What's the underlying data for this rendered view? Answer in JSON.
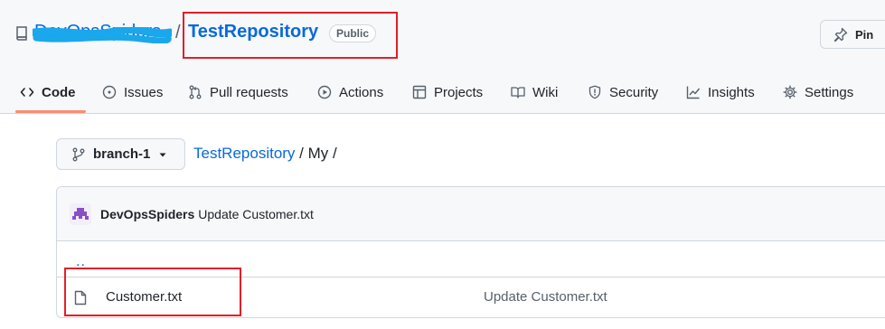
{
  "repo": {
    "owner": "DevOpsSpiders",
    "separator": "/",
    "name": "TestRepository",
    "visibility": "Public"
  },
  "header": {
    "pin_label": "Pin"
  },
  "nav": {
    "tabs": [
      {
        "label": "Code",
        "icon": "code-icon",
        "active": true
      },
      {
        "label": "Issues",
        "icon": "issue-opened-icon"
      },
      {
        "label": "Pull requests",
        "icon": "git-pull-request-icon"
      },
      {
        "label": "Actions",
        "icon": "play-icon"
      },
      {
        "label": "Projects",
        "icon": "table-icon"
      },
      {
        "label": "Wiki",
        "icon": "book-icon"
      },
      {
        "label": "Security",
        "icon": "shield-icon"
      },
      {
        "label": "Insights",
        "icon": "graph-icon"
      },
      {
        "label": "Settings",
        "icon": "gear-icon"
      }
    ]
  },
  "branch": {
    "name": "branch-1"
  },
  "breadcrumb": {
    "repo_link": "TestRepository",
    "path": " / My /"
  },
  "commit": {
    "author": "DevOpsSpiders",
    "message": "Update Customer.txt"
  },
  "files": {
    "parent": "..",
    "rows": [
      {
        "name": "Customer.txt",
        "commit_message": "Update Customer.txt"
      }
    ]
  },
  "colors": {
    "link": "#0969da",
    "highlight_box": "#e0202a",
    "active_tab_underline": "#fd8c73"
  }
}
